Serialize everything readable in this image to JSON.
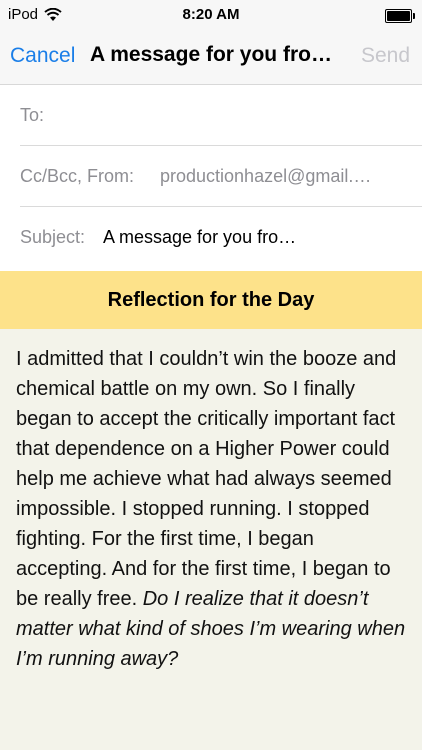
{
  "status_bar": {
    "carrier": "iPod",
    "time": "8:20 AM",
    "battery_level": 1.0
  },
  "nav": {
    "cancel_label": "Cancel",
    "title": "A message for you fro…",
    "send_label": "Send"
  },
  "fields": {
    "to_label": "To:",
    "cc_label": "Cc/Bcc, From:",
    "from_value": "productionhazel@gmail.…",
    "subject_label": "Subject:",
    "subject_value": "A message for you fro…"
  },
  "message": {
    "heading": "Reflection for the Day",
    "body": "I admitted that I couldn’t win the booze and chemical battle on my own. So I finally began to accept the critically important fact that dependence on a Higher Power could help me achieve what had always seemed impossible. I stopped running. I stopped fighting. For the first time, I began accepting. And for the first time, I began to be really free.",
    "question": "Do I realize that it doesn’t matter what kind of shoes I’m wearing when I’m running away?"
  },
  "colors": {
    "accent": "#1a7ee8",
    "banner": "#fde28a",
    "background": "#f3f3ea"
  },
  "icons": [
    "wifi-icon",
    "battery-icon"
  ]
}
